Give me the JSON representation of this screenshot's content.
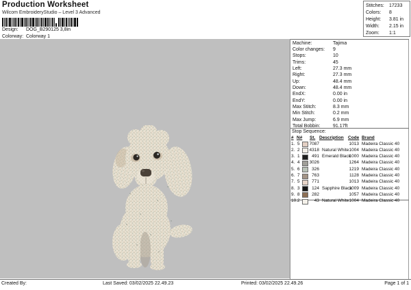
{
  "header": {
    "title": "Production Worksheet",
    "subtitle": "Wilcom EmbroideryStudio – Level 3 Advanced",
    "design_label": "Design:",
    "design_value": "DOG_B290125 3,8in",
    "colorway_label": "Colorway:",
    "colorway_value": "Colorway 1"
  },
  "stats_box": {
    "rows": [
      {
        "label": "Stitches:",
        "value": "17233"
      },
      {
        "label": "Colors:",
        "value": "8"
      },
      {
        "label": "Height:",
        "value": "3.81 in"
      },
      {
        "label": "Width:",
        "value": "2.15 in"
      },
      {
        "label": "Zoom:",
        "value": "1:1"
      }
    ]
  },
  "machine_info": {
    "rows": [
      {
        "label": "Machine:",
        "value": "Tajima"
      },
      {
        "label": "Color changes:",
        "value": "9"
      },
      {
        "label": "Stops:",
        "value": "10"
      },
      {
        "label": "Trims:",
        "value": "45"
      },
      {
        "label": "Left:",
        "value": "27.3 mm"
      },
      {
        "label": "Right:",
        "value": "27.3 mm"
      },
      {
        "label": "Up:",
        "value": "48.4 mm"
      },
      {
        "label": "Down:",
        "value": "48.4 mm"
      },
      {
        "label": "EndX:",
        "value": "0.00 in"
      },
      {
        "label": "EndY:",
        "value": "0.00 in"
      },
      {
        "label": "Max Stitch:",
        "value": "8.3 mm"
      },
      {
        "label": "Min Stitch:",
        "value": "0.2 mm"
      },
      {
        "label": "Max Jump:",
        "value": "6.9 mm"
      },
      {
        "label": "Total Bobbin:",
        "value": "91.17ft"
      }
    ]
  },
  "stop_sequence": {
    "heading": "Stop Sequence:",
    "columns": [
      "#",
      "N#",
      "St.",
      "Description",
      "Code",
      "Brand"
    ],
    "rows": [
      {
        "num": "1.",
        "needle": "5",
        "color": "#e3cfc3",
        "stitches": "7087",
        "description": "",
        "code": "1013",
        "brand": "Madeira Classic 40"
      },
      {
        "num": "2.",
        "needle": "2",
        "color": "#f2efe8",
        "stitches": "4318",
        "description": "Natural White",
        "code": "1004",
        "brand": "Madeira Classic 40"
      },
      {
        "num": "3.",
        "needle": "1",
        "color": "#1f1f1f",
        "stitches": "491",
        "description": "Emerald Black",
        "code": "1000",
        "brand": "Madeira Classic 40"
      },
      {
        "num": "4.",
        "needle": "4",
        "color": "#a09f99",
        "stitches": "3026",
        "description": "",
        "code": "1264",
        "brand": "Madeira Classic 40"
      },
      {
        "num": "5.",
        "needle": "6",
        "color": "#b9c2b7",
        "stitches": "326",
        "description": "",
        "code": "1219",
        "brand": "Madeira Classic 40"
      },
      {
        "num": "6.",
        "needle": "7",
        "color": "#a39486",
        "stitches": "763",
        "description": "",
        "code": "1128",
        "brand": "Madeira Classic 40"
      },
      {
        "num": "7.",
        "needle": "5",
        "color": "#e8d5c8",
        "stitches": "771",
        "description": "",
        "code": "1013",
        "brand": "Madeira Classic 40"
      },
      {
        "num": "8.",
        "needle": "3",
        "color": "#161616",
        "stitches": "124",
        "description": "Sapphire Black",
        "code": "1009",
        "brand": "Madeira Classic 40"
      },
      {
        "num": "9.",
        "needle": "8",
        "color": "#8d6f55",
        "stitches": "282",
        "description": "",
        "code": "1057",
        "brand": "Madeira Classic 40"
      },
      {
        "num": "10.",
        "needle": "2",
        "color": "#f4f1ea",
        "stitches": "43",
        "description": "Natural White",
        "code": "1004",
        "brand": "Madeira Classic 40"
      }
    ]
  },
  "design_preview": {
    "background": "#bfbfbf",
    "subject": "embroidered white poodle dog"
  },
  "footer": {
    "created_by": "Created By:",
    "last_saved": "Last Saved: 03/02/2025 22.49.23",
    "printed": "Printed: 03/02/2025 22.49.26",
    "page": "Page 1 of 1"
  }
}
